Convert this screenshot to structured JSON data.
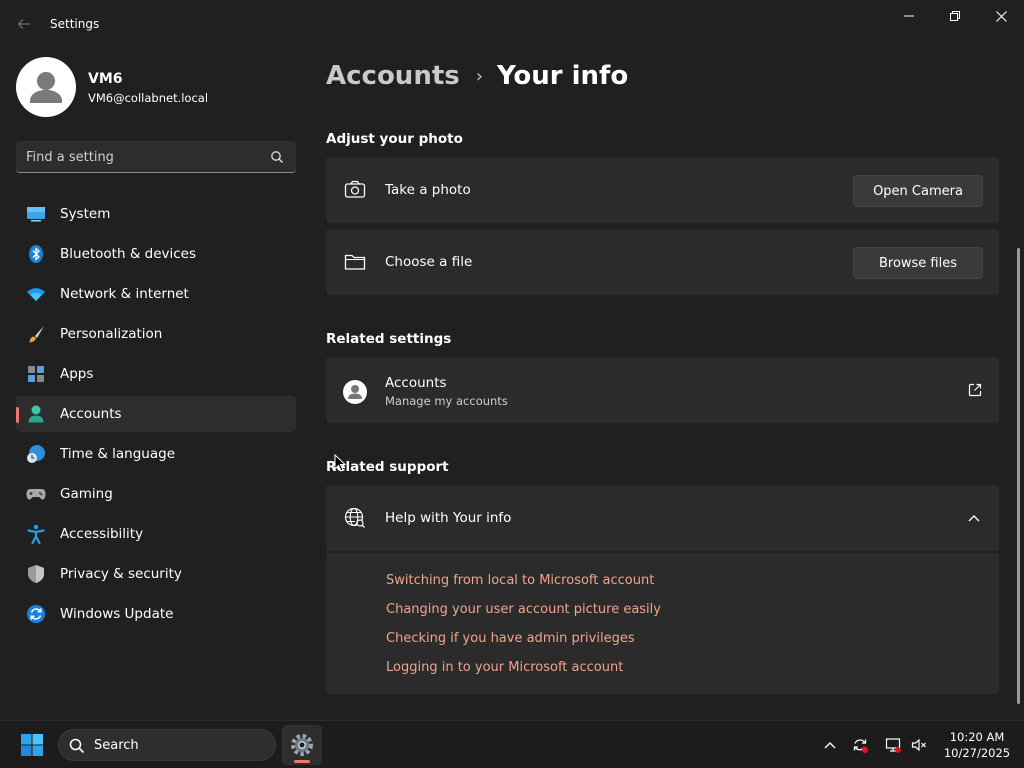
{
  "window": {
    "title": "Settings"
  },
  "profile": {
    "name": "VM6",
    "email": "VM6@collabnet.local"
  },
  "search": {
    "placeholder": "Find a setting"
  },
  "nav": {
    "items": [
      {
        "label": "System",
        "icon": "monitor-icon"
      },
      {
        "label": "Bluetooth & devices",
        "icon": "bluetooth-icon"
      },
      {
        "label": "Network & internet",
        "icon": "wifi-icon"
      },
      {
        "label": "Personalization",
        "icon": "brush-icon"
      },
      {
        "label": "Apps",
        "icon": "apps-icon"
      },
      {
        "label": "Accounts",
        "icon": "person-icon",
        "selected": true
      },
      {
        "label": "Time & language",
        "icon": "clock-globe-icon"
      },
      {
        "label": "Gaming",
        "icon": "gamepad-icon"
      },
      {
        "label": "Accessibility",
        "icon": "accessibility-icon"
      },
      {
        "label": "Privacy & security",
        "icon": "shield-icon"
      },
      {
        "label": "Windows Update",
        "icon": "update-icon"
      }
    ]
  },
  "breadcrumb": {
    "parent": "Accounts",
    "separator": "›",
    "current": "Your info"
  },
  "photo": {
    "section_title": "Adjust your photo",
    "take_photo": {
      "label": "Take a photo",
      "button": "Open Camera"
    },
    "choose_file": {
      "label": "Choose a file",
      "button": "Browse files"
    }
  },
  "related_settings": {
    "section_title": "Related settings",
    "accounts": {
      "label": "Accounts",
      "sublabel": "Manage my accounts"
    }
  },
  "related_support": {
    "section_title": "Related support",
    "help": {
      "label": "Help with Your info",
      "links": [
        "Switching from local to Microsoft account",
        "Changing your user account picture easily",
        "Checking if you have admin privileges",
        "Logging in to your Microsoft account"
      ]
    }
  },
  "taskbar": {
    "search_label": "Search",
    "time": "10:20 AM",
    "date": "10/27/2025"
  },
  "colors": {
    "accent": "#f0796b",
    "link": "#f0a48c",
    "background": "#202020",
    "card": "#2b2b2b"
  }
}
